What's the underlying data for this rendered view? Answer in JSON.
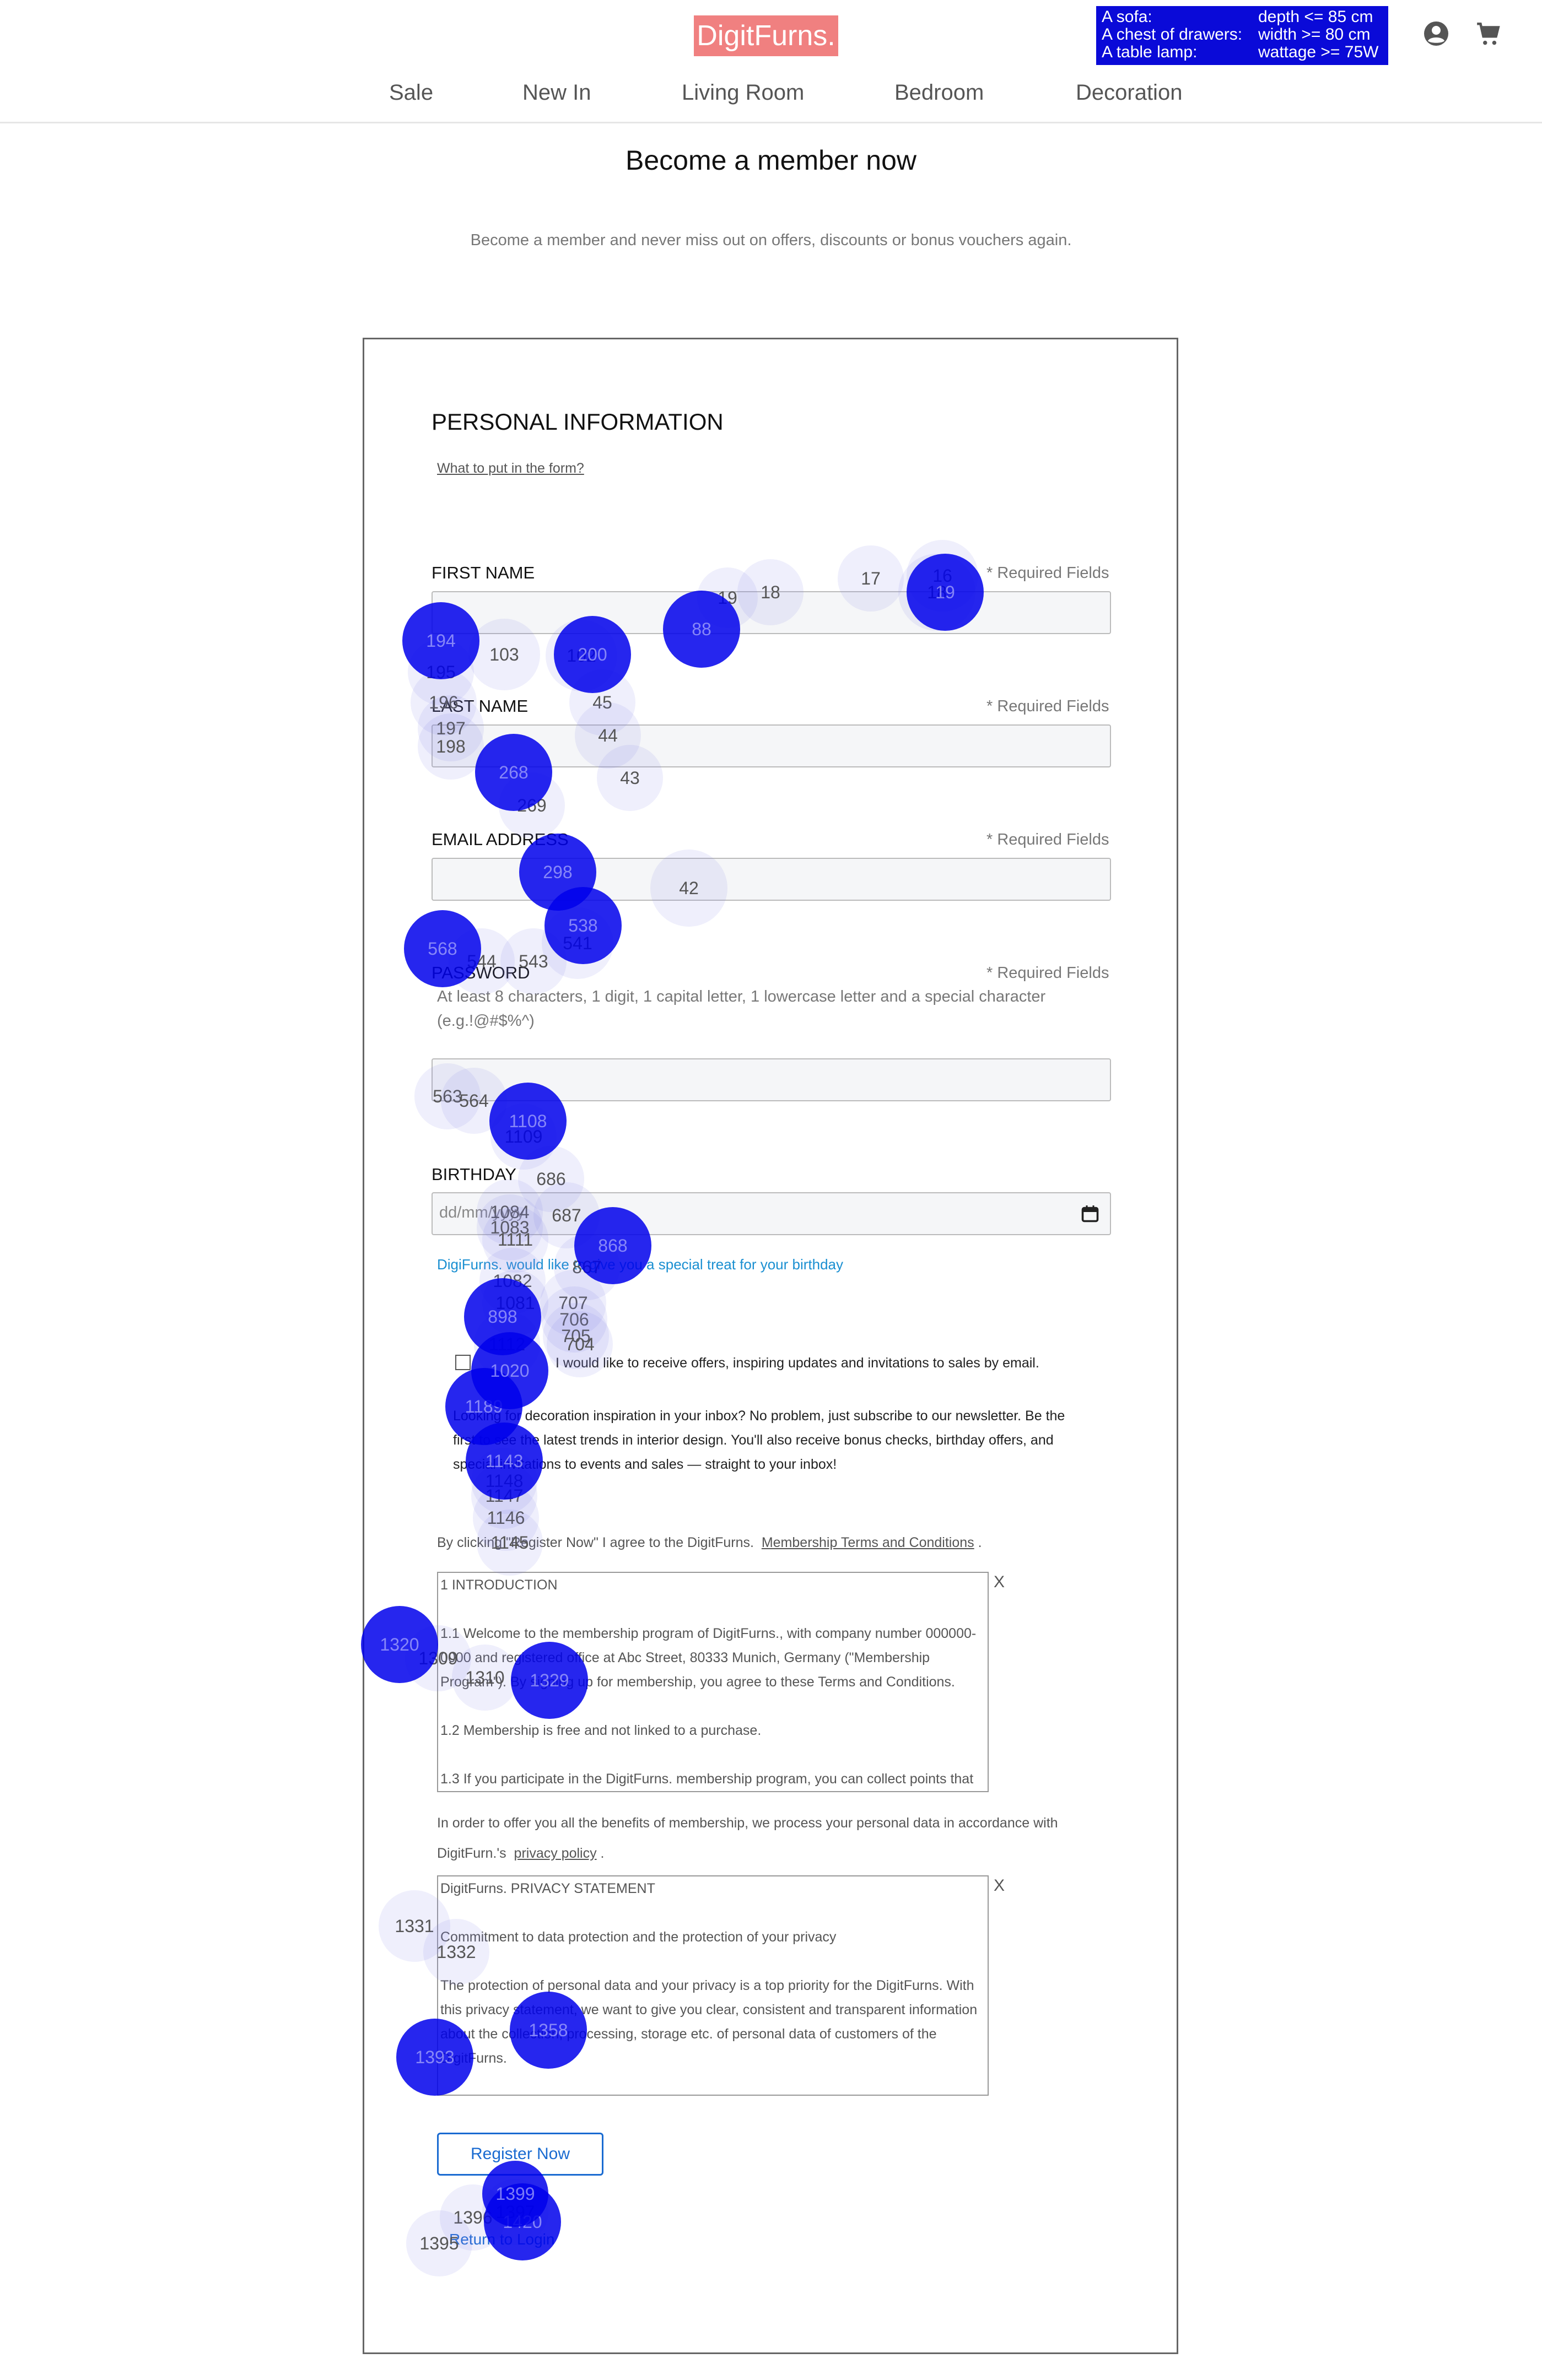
{
  "header": {
    "logo": "DigitFurns.",
    "requirements": [
      {
        "item": "A sofa:",
        "rule": "depth <= 85 cm"
      },
      {
        "item": "A chest of drawers:",
        "rule": "width >= 80 cm"
      },
      {
        "item": "A table lamp:",
        "rule": "wattage >= 75W"
      }
    ],
    "account_icon": "account-circle-icon",
    "cart_icon": "shopping-cart-icon",
    "nav": [
      "Sale",
      "New In",
      "Living Room",
      "Bedroom",
      "Decoration"
    ]
  },
  "page": {
    "title": "Become a member now",
    "subtitle": "Become a member and never miss out on offers, discounts or bonus vouchers again."
  },
  "form": {
    "section_title": "PERSONAL INFORMATION",
    "help_link": "What to put in the form?",
    "required_text": "* Required Fields",
    "first_name_label": "FIRST NAME",
    "last_name_label": "LAST NAME",
    "email_label": "EMAIL ADDRESS",
    "password_label": "PASSWORD",
    "password_hint": "At least 8 characters, 1 digit, 1 capital letter, 1 lowercase letter and a special character (e.g.!@#$%^)",
    "birthday_label": "BIRTHDAY",
    "birthday_placeholder": "dd/mm/yyyy",
    "birthday_note": "DigiFurns. would like to give you a special treat for your birthday",
    "optin_text": "I would like to receive offers, inspiring updates and invitations to sales by email.",
    "newsletter_text": "Looking for decoration inspiration in your inbox? No problem, just subscribe to our newsletter. Be the first to see the latest trends in interior design. You'll also receive bonus checks, birthday offers, and special invitations to events and sales — straight to your inbox!",
    "terms_intro": "By clicking \"Register Now\" I agree to the DigitFurns.",
    "terms_link": "Membership Terms and Conditions",
    "terms_box": [
      "1 INTRODUCTION",
      "",
      "1.1 Welcome to the membership program of DigitFurns., with company number 000000-0000 and registered office at Abc Street, 80333 Munich, Germany (\"Membership Program\"). By signing up for membership, you agree to these Terms and Conditions.",
      "",
      "1.2 Membership is free and not linked to a purchase.",
      "",
      "1.3 If you participate in the DigitFurns. membership program, you can collect points that"
    ],
    "privacy_intro": "In order to offer you all the benefits of membership, we process your personal data in accordance with DigitFurn.'s",
    "privacy_link": "privacy policy",
    "privacy_box": [
      "DigitFurns. PRIVACY STATEMENT",
      "",
      "Commitment to data protection and the protection of your privacy",
      "",
      "The protection of personal data and your privacy is a top priority for the DigitFurns. With this privacy statement, we want to give you clear, consistent and transparent information about the collection, processing, storage etc. of personal data of customers of the DigitFurns."
    ],
    "close_label": "X",
    "register_button": "Register Now",
    "return_link": "Return to Login"
  },
  "gaze_overlay": {
    "color": "#0000eb",
    "fixations": [
      {
        "label": "18"
      },
      {
        "label": "17"
      },
      {
        "label": "16"
      },
      {
        "label": "18"
      },
      {
        "label": "19"
      },
      {
        "label": "103"
      },
      {
        "label": "102"
      },
      {
        "label": "195"
      },
      {
        "label": "196"
      },
      {
        "label": "197"
      },
      {
        "label": "198"
      },
      {
        "label": "45"
      },
      {
        "label": "44"
      },
      {
        "label": "43"
      },
      {
        "label": "269"
      },
      {
        "label": "42"
      },
      {
        "label": "541"
      },
      {
        "label": "543"
      },
      {
        "label": "544"
      },
      {
        "label": "563"
      },
      {
        "label": "564"
      },
      {
        "label": "1109"
      },
      {
        "label": "686"
      },
      {
        "label": "1084"
      },
      {
        "label": "1083"
      },
      {
        "label": "687"
      },
      {
        "label": "1111"
      },
      {
        "label": "1082"
      },
      {
        "label": "867"
      },
      {
        "label": "1081"
      },
      {
        "label": "707"
      },
      {
        "label": "706"
      },
      {
        "label": "705"
      },
      {
        "label": "704"
      },
      {
        "label": "1112"
      },
      {
        "label": "1148"
      },
      {
        "label": "1147"
      },
      {
        "label": "1146"
      },
      {
        "label": "1145"
      },
      {
        "label": "1309"
      },
      {
        "label": "1310"
      },
      {
        "label": "1331"
      },
      {
        "label": "1332"
      },
      {
        "label": "1396"
      },
      {
        "label": "1395"
      },
      {
        "label": "1397"
      },
      {
        "label": "194"
      },
      {
        "label": "1320"
      },
      {
        "label": "1329"
      },
      {
        "label": "1358"
      },
      {
        "label": "1393"
      },
      {
        "label": "1420"
      },
      {
        "label": "1399"
      },
      {
        "label": "1189"
      },
      {
        "label": "1143"
      },
      {
        "label": "1020"
      },
      {
        "label": "898"
      },
      {
        "label": "868"
      },
      {
        "label": "1108"
      },
      {
        "label": "538"
      },
      {
        "label": "568"
      },
      {
        "label": "298"
      },
      {
        "label": "268"
      },
      {
        "label": "200"
      },
      {
        "label": "88"
      },
      {
        "label": "19"
      }
    ]
  }
}
